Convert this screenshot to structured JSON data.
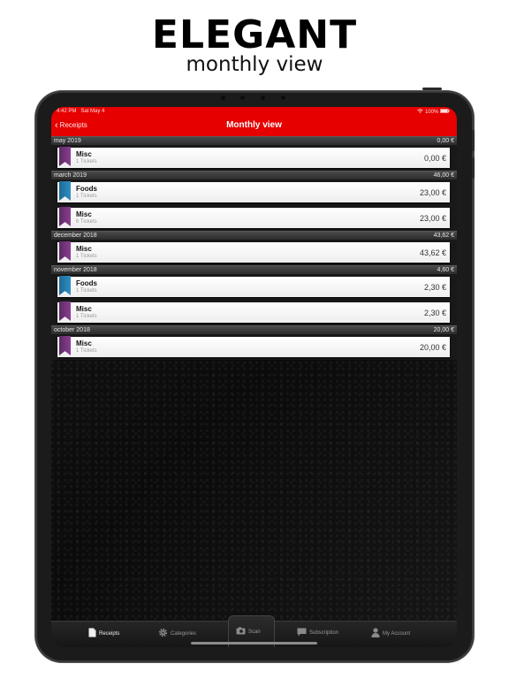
{
  "promo": {
    "title": "ELEGANT",
    "subtitle": "monthly view"
  },
  "status_bar": {
    "time": "4:42 PM",
    "date": "Sat May 4",
    "battery": "100%"
  },
  "navbar": {
    "back_label": "Receipts",
    "title": "Monthly view",
    "color": "#e60000"
  },
  "sections": [
    {
      "month": "may 2019",
      "total": "0,00 €",
      "rows": [
        {
          "category": "Misc",
          "tickets": "1 Tickets",
          "amount": "0,00 €",
          "color": "misc"
        }
      ]
    },
    {
      "month": "march 2019",
      "total": "46,00 €",
      "rows": [
        {
          "category": "Foods",
          "tickets": "1 Tickets",
          "amount": "23,00 €",
          "color": "foods"
        },
        {
          "category": "Misc",
          "tickets": "6 Tickets",
          "amount": "23,00 €",
          "color": "misc"
        }
      ]
    },
    {
      "month": "december 2018",
      "total": "43,62 €",
      "rows": [
        {
          "category": "Misc",
          "tickets": "1 Tickets",
          "amount": "43,62 €",
          "color": "misc"
        }
      ]
    },
    {
      "month": "november 2018",
      "total": "4,60 €",
      "rows": [
        {
          "category": "Foods",
          "tickets": "1 Tickets",
          "amount": "2,30 €",
          "color": "foods"
        },
        {
          "category": "Misc",
          "tickets": "1 Tickets",
          "amount": "2,30 €",
          "color": "misc"
        }
      ]
    },
    {
      "month": "october 2018",
      "total": "20,00 €",
      "rows": [
        {
          "category": "Misc",
          "tickets": "1 Tickets",
          "amount": "20,00 €",
          "color": "misc"
        }
      ]
    }
  ],
  "tabs": {
    "receipts": "Receipts",
    "categories": "Categories",
    "scan": "Scan",
    "subscription": "Subscription",
    "account": "My Account"
  },
  "icons": {
    "back": "chevron-left-icon",
    "receipts": "document-icon",
    "categories": "gear-icon",
    "scan": "camera-icon",
    "subscription": "chat-bubble-icon",
    "account": "person-icon",
    "wifi": "wifi-icon",
    "battery": "battery-icon"
  },
  "colors": {
    "misc": "#7a3583",
    "foods": "#2a80b5"
  }
}
